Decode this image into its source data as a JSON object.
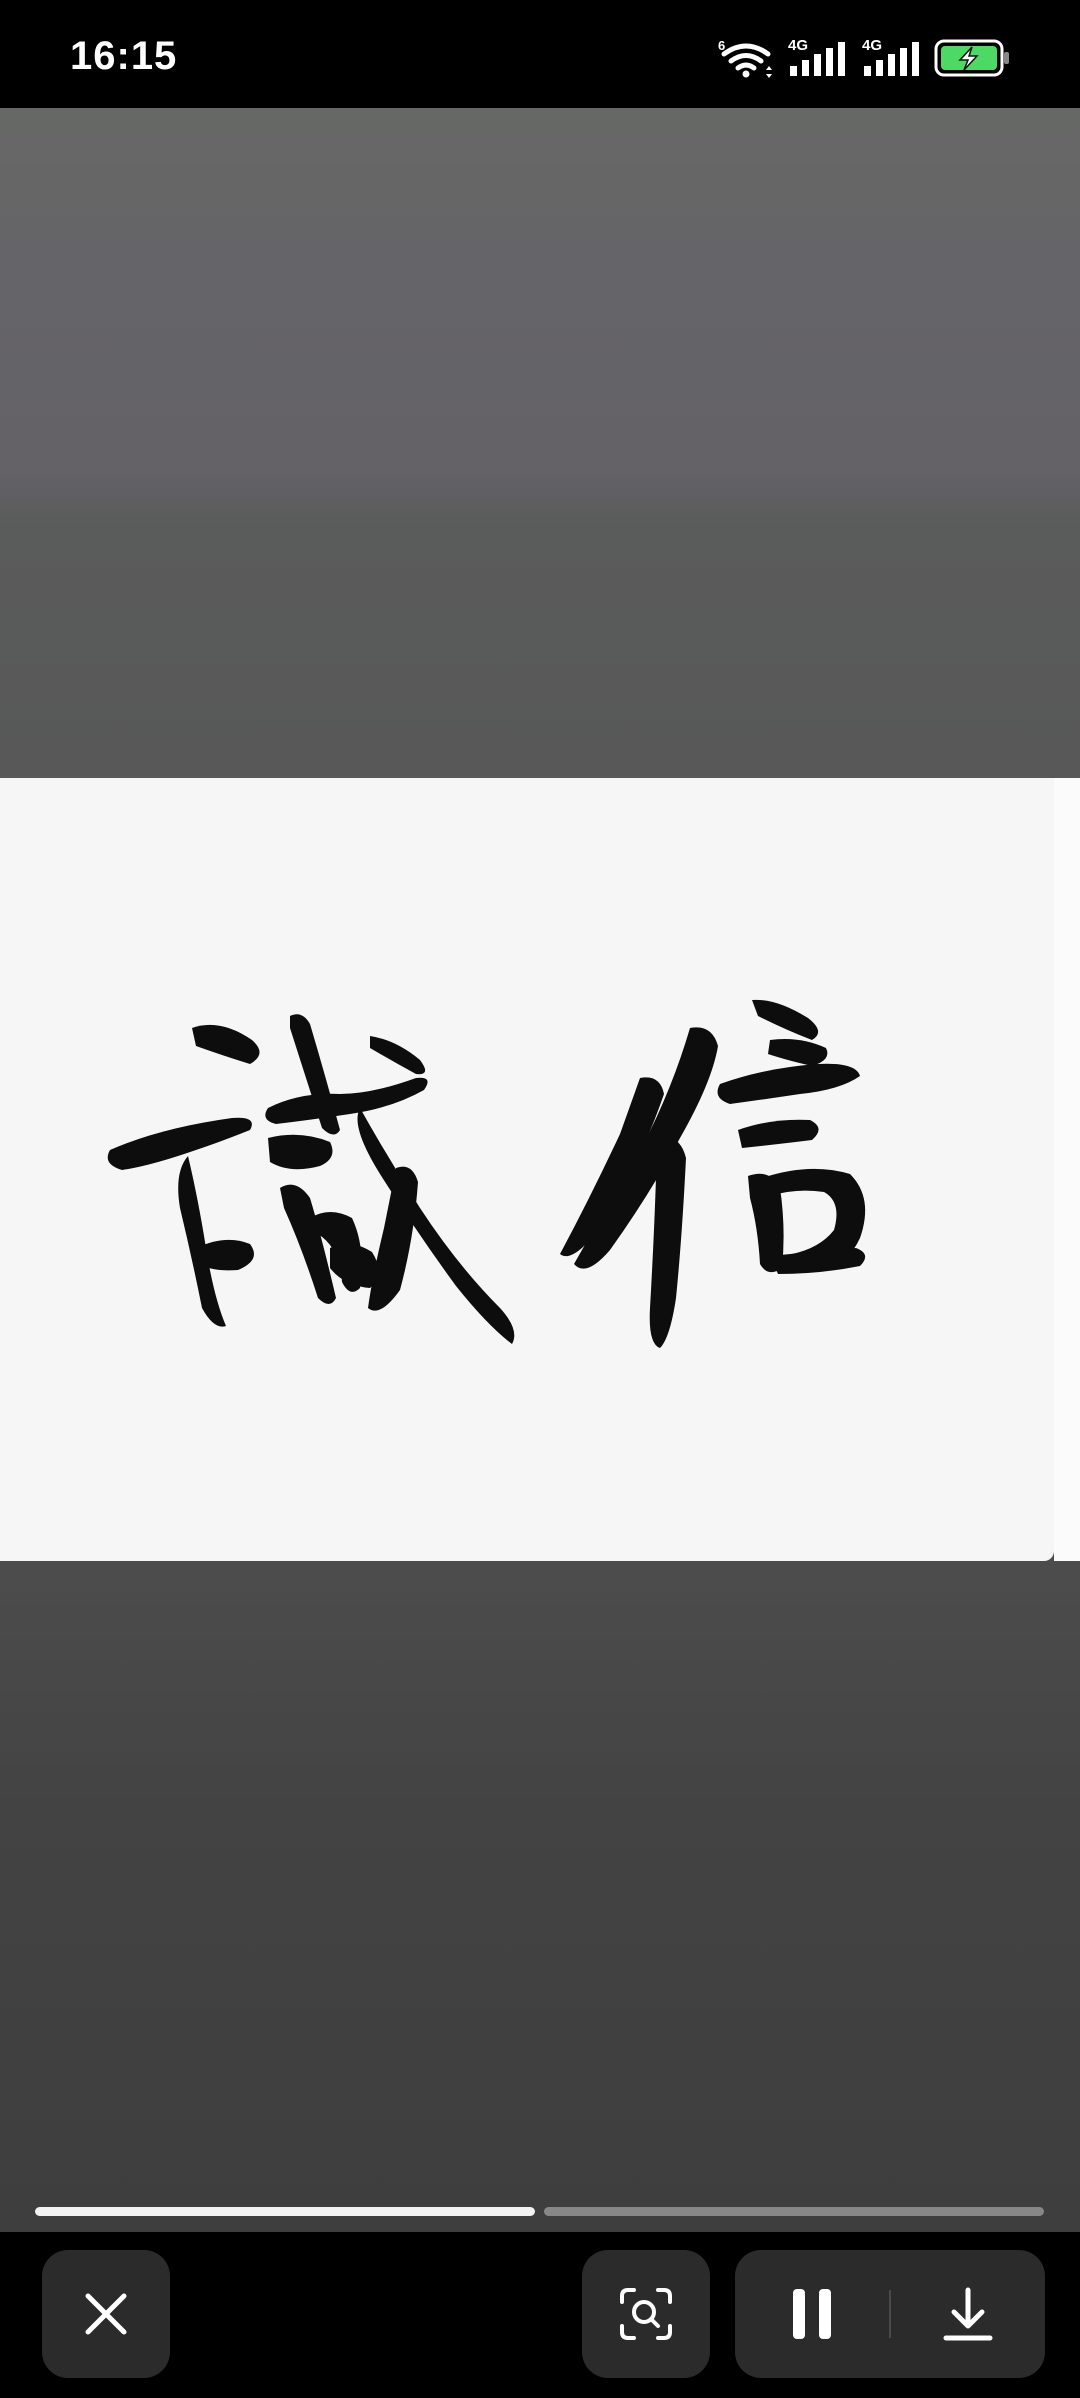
{
  "status_bar": {
    "time": "16:15",
    "wifi_icon": "wifi-6-icon",
    "wifi_badge": "6",
    "sim1_label": "4G",
    "sim2_label": "4G",
    "battery_icon": "battery-charging-icon",
    "battery_color": "#4cd964"
  },
  "viewer": {
    "image_text": "誠信",
    "image_background": "#f6f6f6",
    "progress": {
      "segments": [
        {
          "fraction": 1.0
        },
        {
          "fraction": 0.0
        }
      ]
    }
  },
  "controls": {
    "close_icon": "close-icon",
    "lens_icon": "image-search-icon",
    "pause_icon": "pause-icon",
    "download_icon": "download-icon"
  }
}
